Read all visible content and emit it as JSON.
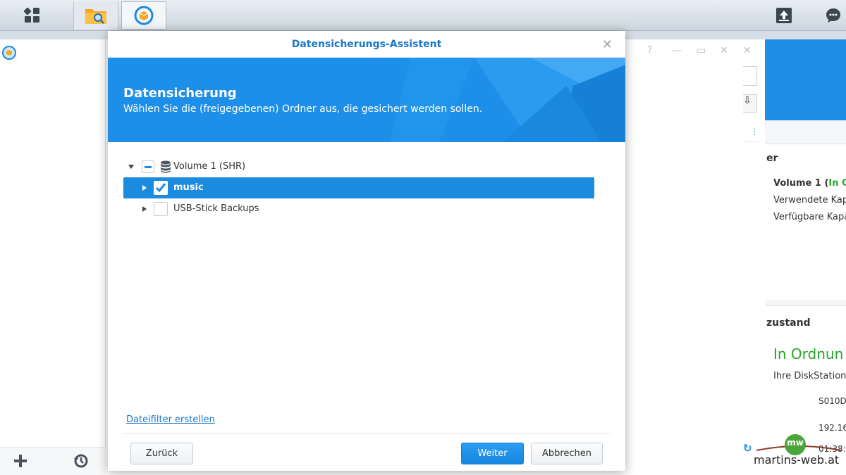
{
  "dialog": {
    "title": "Datensicherungs-Assistent",
    "banner_title": "Datensicherung",
    "banner_subtitle": "Wählen Sie die (freigegebenen) Ordner aus, die gesichert werden sollen.",
    "tree": {
      "root_label": "Volume 1 (SHR)",
      "items": [
        {
          "label": "music",
          "checked": true,
          "selected": true
        },
        {
          "label": "USB-Stick Backups",
          "checked": false,
          "selected": false
        }
      ]
    },
    "file_filter_link": "Dateifilter erstellen",
    "back_button": "Zurück",
    "next_button": "Weiter",
    "cancel_button": "Abbrechen"
  },
  "right_panel": {
    "volume_title": "Volume 1 (",
    "volume_status": "In O",
    "used_capacity": "Verwendete Kap",
    "free_capacity": "Verfügbare Kapa",
    "partial_heading": "er",
    "health_heading": "zustand",
    "health_status": "In Ordnun",
    "health_desc": "Ihre DiskStation",
    "info1": "S010D",
    "info2": "192.16",
    "info3": "01:38:"
  },
  "watermark": {
    "text": "martins-web.at",
    "badge": "mw"
  },
  "colors": {
    "accent": "#1b8be0",
    "status_ok": "#2aa52a",
    "banner": "#1e8fe8"
  }
}
